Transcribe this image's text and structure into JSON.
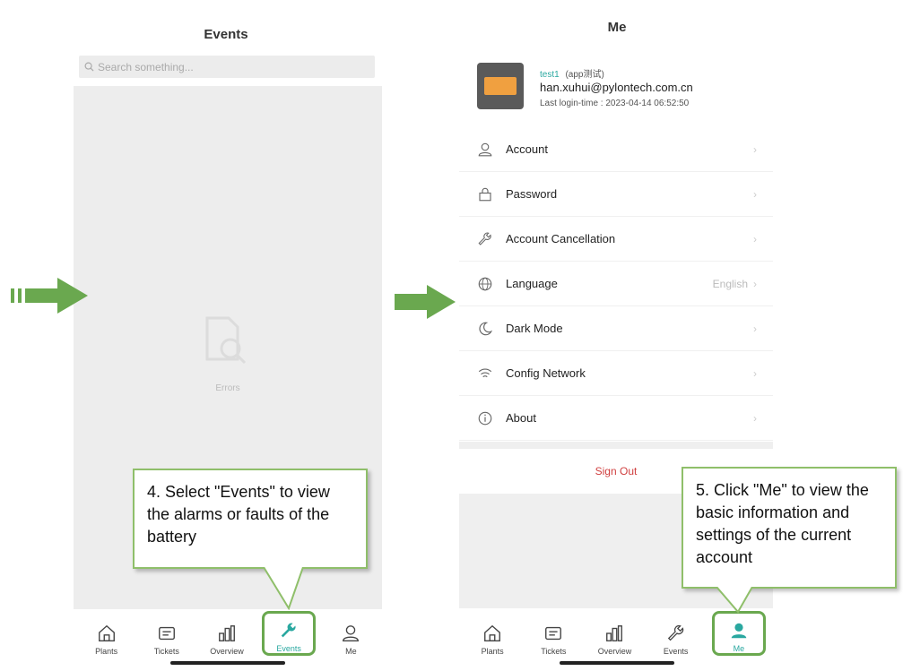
{
  "left_screen": {
    "title": "Events",
    "search_placeholder": "Search something...",
    "empty_text": "Errors",
    "tabs": [
      {
        "label": "Plants",
        "icon": "house-icon"
      },
      {
        "label": "Tickets",
        "icon": "ticket-icon"
      },
      {
        "label": "Overview",
        "icon": "bar-chart-icon"
      },
      {
        "label": "Events",
        "icon": "wrench-icon",
        "active": true
      },
      {
        "label": "Me",
        "icon": "person-icon"
      }
    ],
    "callout": "4. Select \"Events\" to view the alarms or faults of the battery"
  },
  "right_screen": {
    "title": "Me",
    "user": {
      "name": "test1",
      "tag": "(app测试)",
      "email": "han.xuhui@pylontech.com.cn",
      "last_login": "Last login-time :  2023-04-14 06:52:50"
    },
    "menu": [
      {
        "label": "Account",
        "icon": "user-icon",
        "value": ""
      },
      {
        "label": "Password",
        "icon": "lock-icon",
        "value": ""
      },
      {
        "label": "Account Cancellation",
        "icon": "wrench-icon",
        "value": ""
      },
      {
        "label": "Language",
        "icon": "globe-icon",
        "value": "English"
      },
      {
        "label": "Dark Mode",
        "icon": "moon-icon",
        "value": ""
      },
      {
        "label": "Config Network",
        "icon": "wifi-icon",
        "value": ""
      },
      {
        "label": "About",
        "icon": "info-icon",
        "value": ""
      }
    ],
    "sign_out": "Sign Out",
    "tabs": [
      {
        "label": "Plants",
        "icon": "house-icon"
      },
      {
        "label": "Tickets",
        "icon": "ticket-icon"
      },
      {
        "label": "Overview",
        "icon": "bar-chart-icon"
      },
      {
        "label": "Events",
        "icon": "wrench-icon"
      },
      {
        "label": "Me",
        "icon": "person-icon",
        "active": true
      }
    ],
    "callout": "5. Click \"Me\" to view the basic information and settings of the current account"
  },
  "colors": {
    "arrow": "#6aa84f",
    "callout_border": "#8fbf6a",
    "accent_teal": "#2aa8a0",
    "sign_out": "#d04040"
  }
}
